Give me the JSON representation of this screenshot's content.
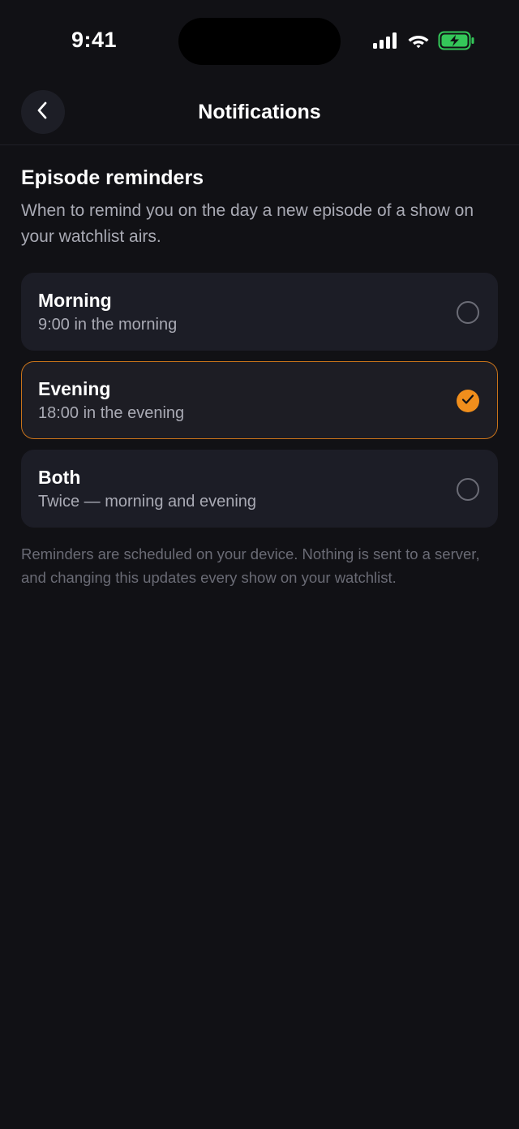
{
  "status_bar": {
    "time": "9:41",
    "icons": [
      "signal-icon",
      "wifi-icon",
      "battery-charging-icon"
    ],
    "battery_color": "#34c759"
  },
  "nav": {
    "back_icon": "chevron-left-icon",
    "title": "Notifications"
  },
  "section": {
    "title": "Episode reminders",
    "description": "When to remind you on the day a new episode of a show on your watchlist airs."
  },
  "options": [
    {
      "title": "Morning",
      "subtitle": "9:00 in the morning",
      "selected": false
    },
    {
      "title": "Evening",
      "subtitle": "18:00 in the evening",
      "selected": true
    },
    {
      "title": "Both",
      "subtitle": "Twice — morning and evening",
      "selected": false
    }
  ],
  "footer_note": "Reminders are scheduled on your device. Nothing is sent to a server, and changing this updates every show on your watchlist.",
  "colors": {
    "background": "#111115",
    "card": "#1c1d26",
    "accent": "#f08e1c",
    "selected_border": "#c8731a"
  }
}
